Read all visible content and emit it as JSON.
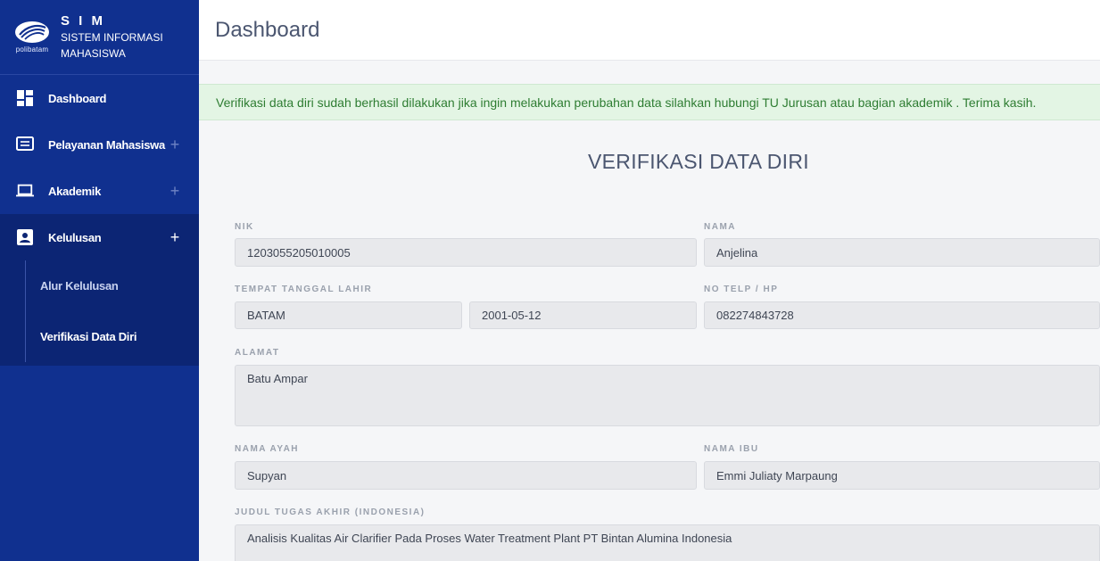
{
  "brand": {
    "logo_text": "polibatam",
    "title": "S I M",
    "subtitle": "SISTEM INFORMASI MAHASISWA"
  },
  "sidebar": {
    "items": [
      {
        "label": "Dashboard",
        "icon": "dashboard-icon"
      },
      {
        "label": "Pelayanan Mahasiswa",
        "icon": "list-icon",
        "expand": "+"
      },
      {
        "label": "Akademik",
        "icon": "laptop-icon",
        "expand": "+"
      },
      {
        "label": "Kelulusan",
        "icon": "badge-icon",
        "expand": "+"
      }
    ],
    "submenu": [
      {
        "label": "Alur Kelulusan"
      },
      {
        "label": "Verifikasi Data Diri"
      }
    ]
  },
  "header": {
    "title": "Dashboard"
  },
  "alert": {
    "text": "Verifikasi data diri sudah berhasil dilakukan jika ingin melakukan perubahan data silahkan hubungi TU Jurusan atau bagian akademik . Terima kasih."
  },
  "form": {
    "title": "VERIFIKASI DATA DIRI",
    "nik": {
      "label": "NIK",
      "value": "1203055205010005"
    },
    "nama": {
      "label": "NAMA",
      "value": "Anjelina"
    },
    "ttl": {
      "label": "TEMPAT TANGGAL LAHIR",
      "place": "BATAM",
      "date": "2001-05-12"
    },
    "telp": {
      "label": "NO TELP / HP",
      "value": "082274843728"
    },
    "alamat": {
      "label": "ALAMAT",
      "value": "Batu Ampar"
    },
    "ayah": {
      "label": "NAMA AYAH",
      "value": "Supyan"
    },
    "ibu": {
      "label": "NAMA IBU",
      "value": "Emmi Juliaty Marpaung"
    },
    "judul": {
      "label": "JUDUL TUGAS AKHIR (INDONESIA)",
      "value": "Analisis Kualitas Air Clarifier Pada Proses Water Treatment Plant PT Bintan Alumina Indonesia"
    }
  },
  "colors": {
    "sidebar": "#10308f",
    "sidebar_active": "#0c2574",
    "alert_bg": "#e3f5e4",
    "alert_text": "#2e7d32"
  }
}
